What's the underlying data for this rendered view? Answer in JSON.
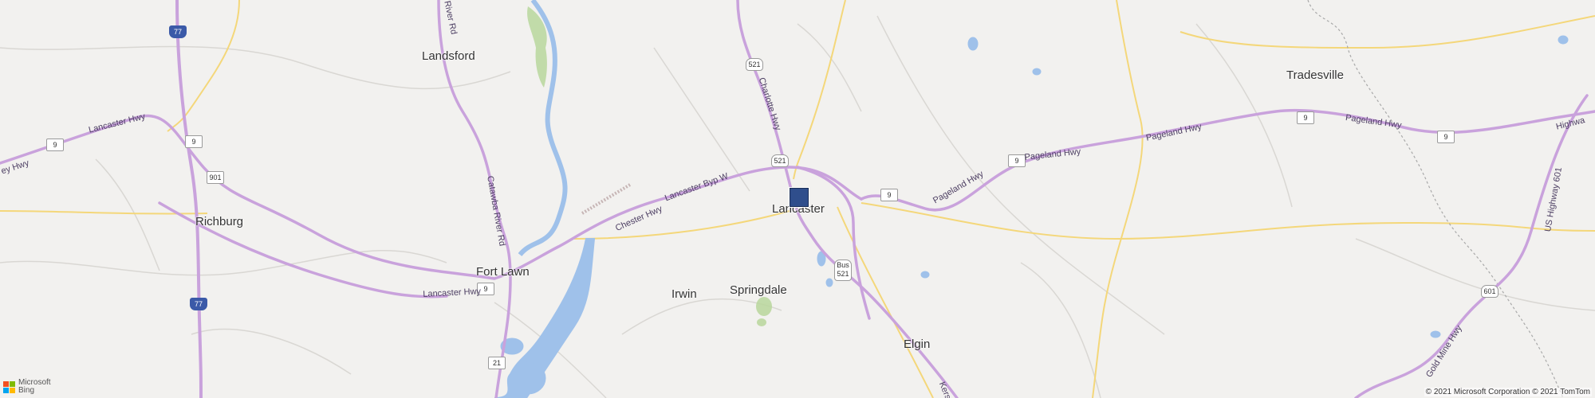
{
  "places": {
    "landsford": "Landsford",
    "tradesville": "Tradesville",
    "richburg": "Richburg",
    "fort_lawn": "Fort Lawn",
    "lancaster": "Lancaster",
    "irwin": "Irwin",
    "springdale": "Springdale",
    "elgin": "Elgin"
  },
  "shields": {
    "i77_top": "77",
    "i77_bottom": "77",
    "us521_north": "521",
    "us521_mid": "521",
    "bus521": "Bus 521",
    "sc9_west": "9",
    "sc9_richburg": "9",
    "sc9_fortlawn": "9",
    "sc9_east1": "9",
    "sc9_east2": "9",
    "sc9_east3": "9",
    "sc9_east4": "9",
    "sc901": "901",
    "sc21": "21",
    "us601": "601"
  },
  "road_labels": {
    "lancaster_hwy_w": "Lancaster Hwy",
    "hwy_far_w": "ey Hwy",
    "chester_hwy": "Chester Hwy",
    "lancaster_byp": "Lancaster Byp W",
    "lancaster_hwy_s": "Lancaster Hwy",
    "catawba_river_rd": "Catawba River Rd",
    "charlotte_hwy": "Charlotte Hwy",
    "pageland_hwy_1": "Pageland Hwy",
    "pageland_hwy_2": "Pageland Hwy",
    "pageland_hwy_3": "Pageland Hwy",
    "pageland_hwy_4": "Pageland Hwy",
    "highway_e": "Highwa",
    "us_highway_601": "US Highway 601",
    "gold_mine_hwy": "Gold Mine Hwy",
    "river_rd": "River Rd",
    "kershaw": "Kersh"
  },
  "attribution": {
    "logo_line1": "Microsoft",
    "logo_line2": "Bing",
    "copyright": "© 2021 Microsoft Corporation © 2021 TomTom"
  },
  "colors": {
    "background": "#f2f1ef",
    "highway": "#c9a2dc",
    "minor_road": "#f4d77a",
    "water": "#9fc1ea",
    "park": "#b9d79c",
    "marker": "#2f4e8c"
  }
}
